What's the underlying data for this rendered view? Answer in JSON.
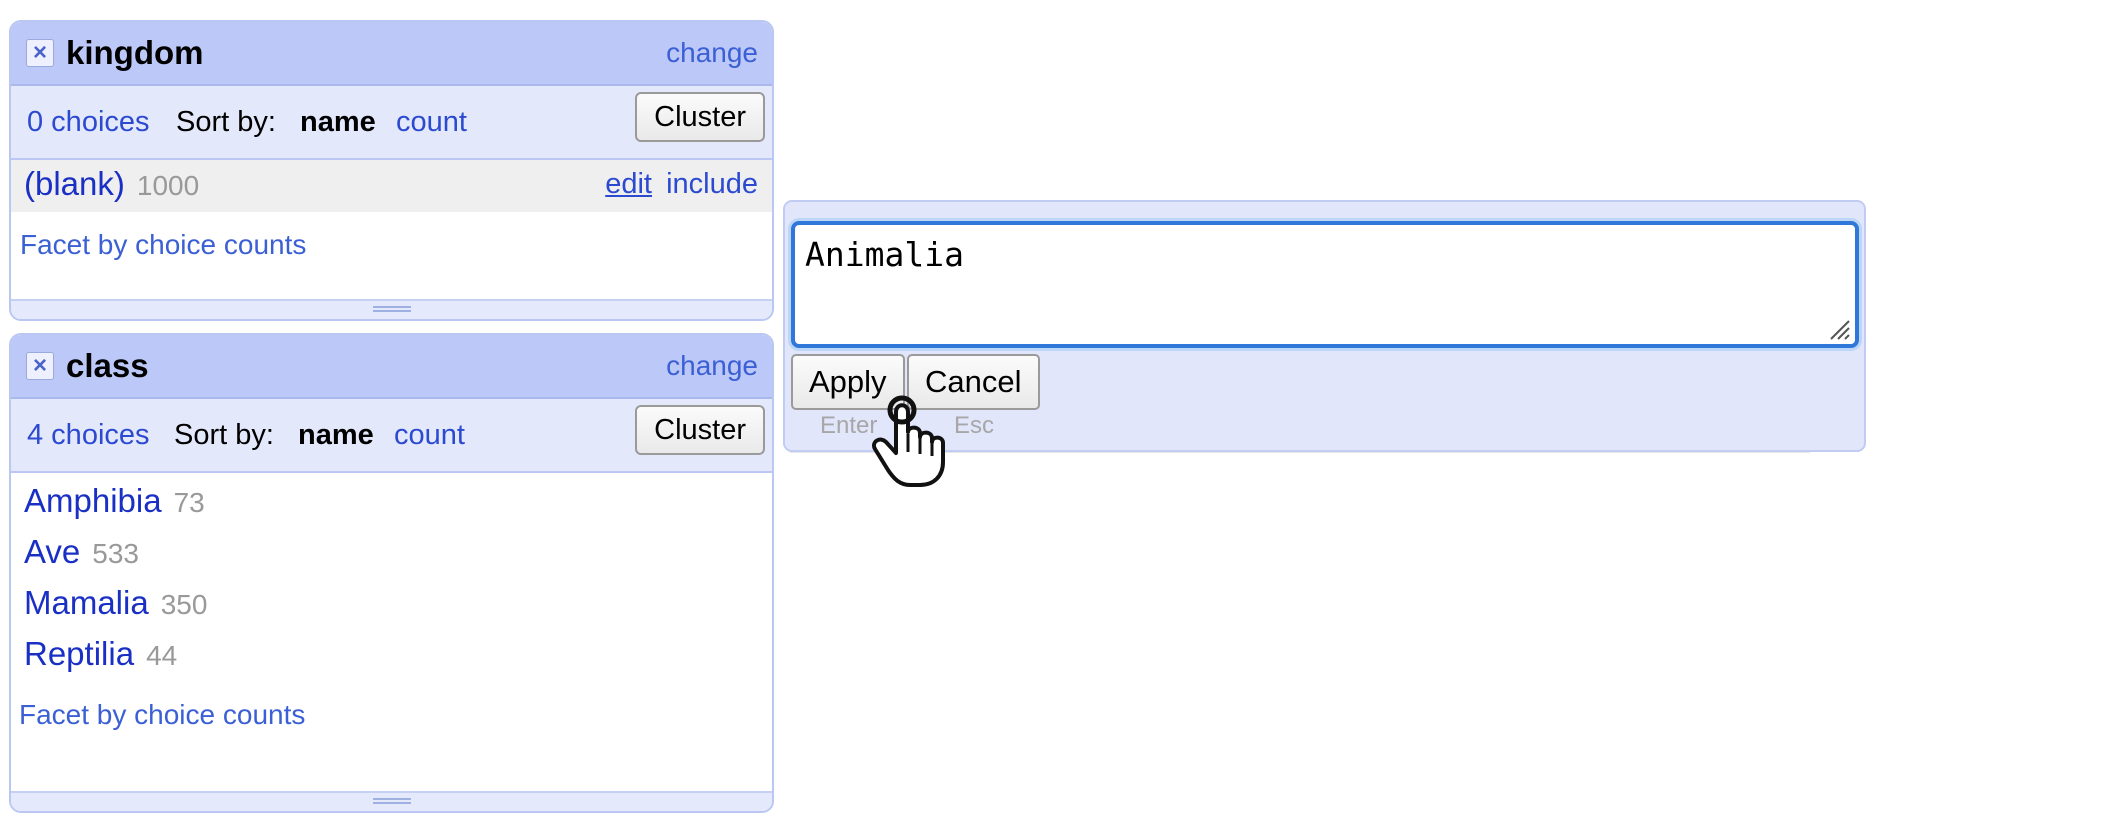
{
  "facets": {
    "kingdom": {
      "title": "kingdom",
      "change_label": "change",
      "choices_label": "0 choices",
      "sort_by_label": "Sort by:",
      "sort_name_label": "name",
      "sort_count_label": "count",
      "cluster_label": "Cluster",
      "blank_choice": {
        "name": "(blank)",
        "count": "1000",
        "edit_label": "edit",
        "include_label": "include"
      },
      "facet_by_counts_label": "Facet by choice counts"
    },
    "class": {
      "title": "class",
      "change_label": "change",
      "choices_label": "4 choices",
      "sort_by_label": "Sort by:",
      "sort_name_label": "name",
      "sort_count_label": "count",
      "cluster_label": "Cluster",
      "choices": [
        {
          "name": "Amphibia",
          "count": "73"
        },
        {
          "name": "Ave",
          "count": "533"
        },
        {
          "name": "Mamalia",
          "count": "350"
        },
        {
          "name": "Reptilia",
          "count": "44"
        }
      ],
      "facet_by_counts_label": "Facet by choice counts"
    }
  },
  "edit_popup": {
    "value": "Animalia",
    "apply_label": "Apply",
    "apply_shortcut": "Enter",
    "cancel_label": "Cancel",
    "cancel_shortcut": "Esc"
  },
  "icons": {
    "remove": "close-icon",
    "cursor": "hand-pointer-icon",
    "resize": "resize-grip-icon"
  },
  "colors": {
    "facet_header_bg": "#bcc8f7",
    "facet_controls_bg": "#e3e8fb",
    "link": "#2c4ad0",
    "focus_border": "#2f77d8"
  }
}
